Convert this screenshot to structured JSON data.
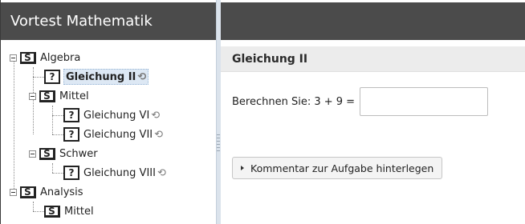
{
  "left_panel": {
    "title": "Vortest Mathematik",
    "tree": [
      {
        "id": "algebra",
        "type": "S",
        "label": "Algebra"
      },
      {
        "id": "gleichung-ii",
        "type": "?",
        "label": "Gleichung II",
        "selected": true,
        "retry_icon": "retry-icon"
      },
      {
        "id": "mittel-1",
        "type": "S",
        "label": "Mittel"
      },
      {
        "id": "gleichung-vi",
        "type": "?",
        "label": "Gleichung VI",
        "retry_icon": "retry-icon"
      },
      {
        "id": "gleichung-vii",
        "type": "?",
        "label": "Gleichung VII",
        "retry_icon": "retry-icon"
      },
      {
        "id": "schwer",
        "type": "S",
        "label": "Schwer"
      },
      {
        "id": "gleichung-viii",
        "type": "?",
        "label": "Gleichung VIII",
        "retry_icon": "retry-icon"
      },
      {
        "id": "analysis",
        "type": "S",
        "label": "Analysis"
      },
      {
        "id": "mittel-2",
        "type": "S",
        "label": "Mittel"
      }
    ]
  },
  "right_panel": {
    "title": "Gleichung II",
    "question_label": "Berechnen Sie: 3 + 9 =",
    "answer_value": "",
    "comment_button": "Kommentar zur Aufgabe hinterlegen"
  },
  "colors": {
    "header_bg": "#4b4b4b",
    "title_bar_bg": "#ececec",
    "selection_bg": "#dde8f4",
    "splitter": "#dbe3ec"
  }
}
